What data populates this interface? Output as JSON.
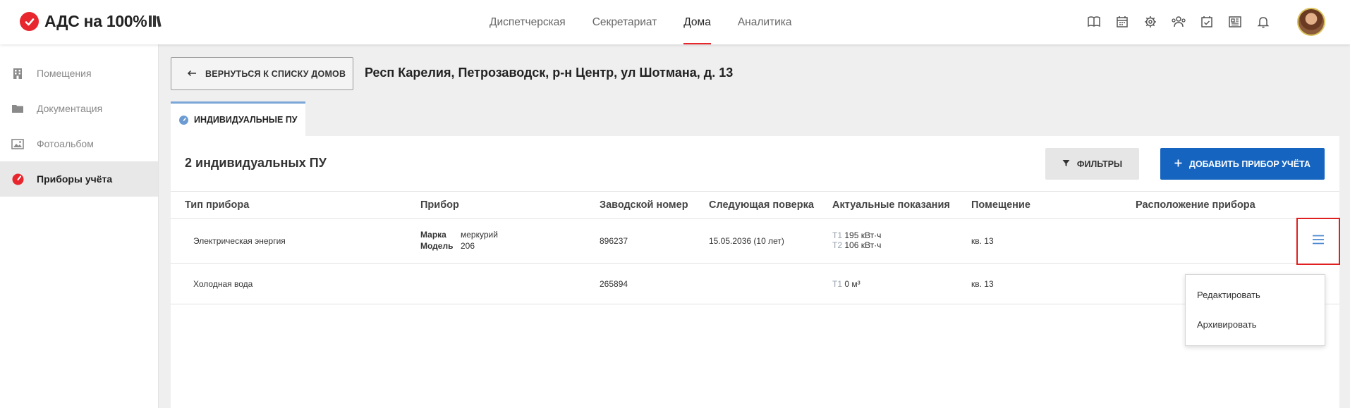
{
  "brand": {
    "logo_text": "АДС на 100%",
    "accent": "#e8262d"
  },
  "nav": {
    "items": [
      {
        "label": "Диспетчерская"
      },
      {
        "label": "Секретариат"
      },
      {
        "label": "Дома"
      },
      {
        "label": "Аналитика"
      }
    ],
    "active_index": 2
  },
  "header_icons": [
    "book-icon",
    "calendar-icon",
    "gear-icon",
    "users-icon",
    "calendar-check-icon",
    "newspaper-icon",
    "bell-icon"
  ],
  "sidebar": {
    "items": [
      {
        "label": "Помещения",
        "icon": "building-icon"
      },
      {
        "label": "Документация",
        "icon": "folder-icon"
      },
      {
        "label": "Фотоальбом",
        "icon": "photos-icon"
      },
      {
        "label": "Приборы учёта",
        "icon": "meter-icon"
      }
    ],
    "active_index": 3
  },
  "back_button": {
    "label": "ВЕРНУТЬСЯ К СПИСКУ ДОМОВ"
  },
  "address": "Респ Карелия, Петрозаводск, р-н Центр, ул Шотмана, д. 13",
  "tab": {
    "label": "ИНДИВИДУАЛЬНЫЕ ПУ"
  },
  "panel": {
    "count_label": "2 индивидуальных ПУ",
    "filter_label": "ФИЛЬТРЫ",
    "add_label": "ДОБАВИТЬ ПРИБОР УЧЁТА",
    "primary_color": "#1565c0"
  },
  "table": {
    "headers": [
      "Тип прибора",
      "Прибор",
      "Заводской номер",
      "Следующая поверка",
      "Актуальные показания",
      "Помещение",
      "Расположение прибора"
    ],
    "rows": [
      {
        "type": "Электрическая энергия",
        "brand_label": "Марка",
        "brand": "меркурий",
        "model_label": "Модель",
        "model": "206",
        "serial": "896237",
        "next_check": "15.05.2036 (10 лет)",
        "readings": [
          {
            "tariff": "T1",
            "value": "195 кВт·ч"
          },
          {
            "tariff": "T2",
            "value": "106 кВт·ч"
          }
        ],
        "room": "кв. 13",
        "location": ""
      },
      {
        "type": "Холодная вода",
        "serial": "265894",
        "next_check": "",
        "readings": [
          {
            "tariff": "T1",
            "value": "0 м³"
          }
        ],
        "room": "кв. 13",
        "location": ""
      }
    ]
  },
  "row_menu": {
    "items": [
      {
        "label": "Редактировать"
      },
      {
        "label": "Архивировать"
      }
    ]
  }
}
